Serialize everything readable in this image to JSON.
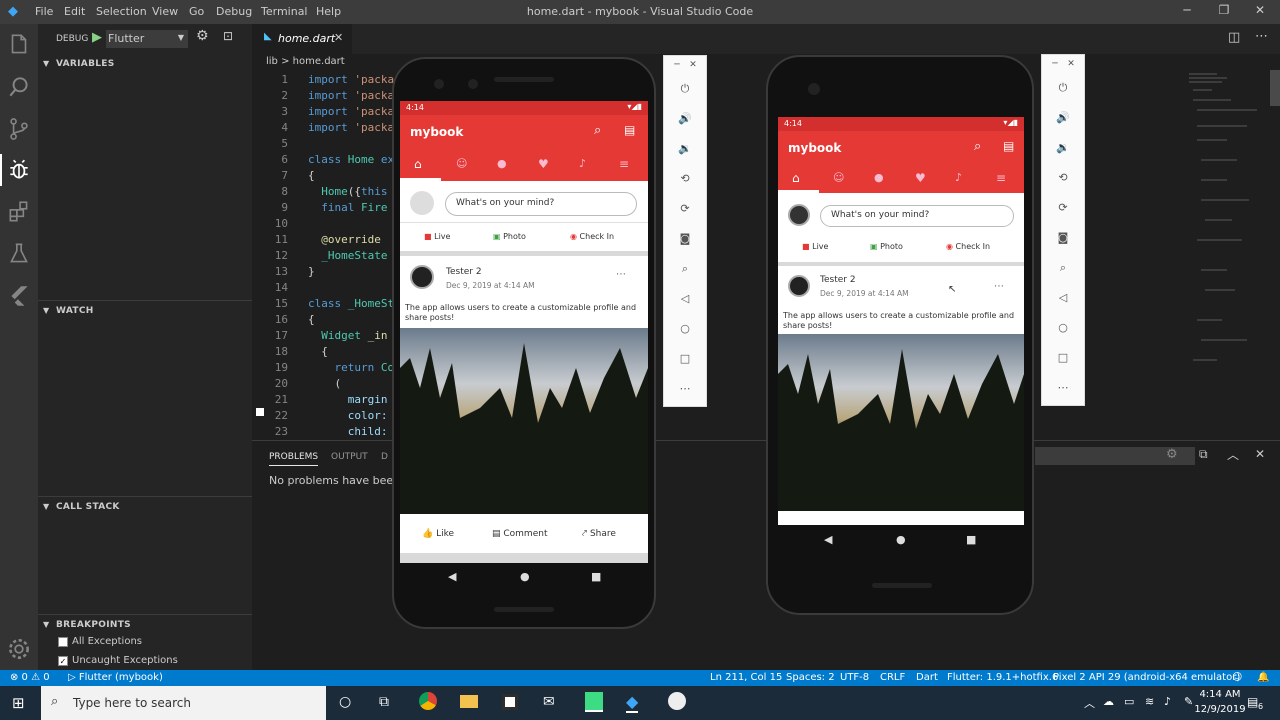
{
  "window": {
    "title": "home.dart - mybook - Visual Studio Code",
    "menu": [
      "File",
      "Edit",
      "Selection",
      "View",
      "Go",
      "Debug",
      "Terminal",
      "Help"
    ]
  },
  "debug": {
    "label": "DEBUG",
    "config": "Flutter"
  },
  "sidebar": {
    "variables": "VARIABLES",
    "watch": "WATCH",
    "call_stack": "CALL STACK",
    "breakpoints": "BREAKPOINTS",
    "bp_items": [
      "All Exceptions",
      "Uncaught Exceptions"
    ]
  },
  "tab": {
    "file": "home.dart"
  },
  "breadcrumb": {
    "folder": "lib",
    "file": "home.dart",
    "sep": ">"
  },
  "editor": {
    "line_numbers": [
      "1",
      "2",
      "3",
      "4",
      "5",
      "6",
      "7",
      "8",
      "9",
      "10",
      "11",
      "12",
      "13",
      "14",
      "15",
      "16",
      "17",
      "18",
      "19",
      "20",
      "21",
      "22",
      "23"
    ]
  },
  "panel": {
    "tabs": [
      "PROBLEMS",
      "OUTPUT",
      "D"
    ],
    "message": "No problems have been d"
  },
  "statusbar": {
    "errors": "⊗ 0 ⚠ 0",
    "launch": "▷ Flutter (mybook)",
    "position": "Ln 211, Col 15",
    "spaces": "Spaces: 2",
    "encoding": "UTF-8",
    "eol": "CRLF",
    "language": "Dart",
    "flutter": "Flutter: 1.9.1+hotfix.6",
    "device": "Pixel 2 API 29 (android-x64 emulator)"
  },
  "taskbar": {
    "search_placeholder": "Type here to search",
    "time": "4:14 AM",
    "date": "12/9/2019",
    "notif": "6"
  },
  "phone_app": {
    "time": "4:14",
    "app_title": "mybook",
    "mind_placeholder": "What's on your mind?",
    "actions": [
      "Live",
      "Photo",
      "Check In"
    ],
    "post_author": "Tester 2",
    "post_date": "Dec 9, 2019 at 4:14 AM",
    "post_text": "The app allows users to create a customizable profile and share posts!",
    "post_actions": [
      "Like",
      "Comment",
      "Share"
    ]
  },
  "colors": {
    "accent": "#007acc",
    "app_red": "#e53935",
    "status_red": "#d32f2f"
  }
}
